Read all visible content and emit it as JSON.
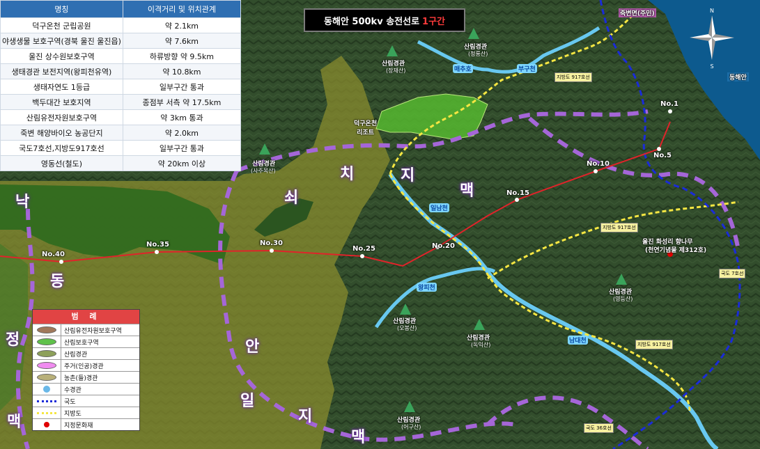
{
  "title": {
    "main": "동해안 500kv 송전선로",
    "highlight": "1구간"
  },
  "table": {
    "headers": [
      "명칭",
      "이격거리 및 위치관계"
    ],
    "rows": [
      [
        "덕구온천 군립공원",
        "약 2.1km"
      ],
      [
        "야생생물 보호구역(경북 울진 울진읍)",
        "약 7.6km"
      ],
      [
        "울진 상수원보호구역",
        "하류방향 약 9.5km"
      ],
      [
        "생태경관 보전지역(왕피천유역)",
        "약 10.8km"
      ],
      [
        "생태자연도 1등급",
        "일부구간 통과"
      ],
      [
        "백두대간 보호지역",
        "종점부 서측 약 17.5km"
      ],
      [
        "산림유전자원보호구역",
        "약 3km 통과"
      ],
      [
        "죽변 해양바이오 농공단지",
        "약 2.0km"
      ],
      [
        "국도7호선,지방도917호선",
        "일부구간 통과"
      ],
      [
        "영동선(철도)",
        "약 20km 이상"
      ]
    ]
  },
  "legend": {
    "title": "범 례",
    "items": [
      {
        "label": "산림유전자원보호구역",
        "icon": "brown-ellipse",
        "color": "#a0785a"
      },
      {
        "label": "산림보호구역",
        "icon": "green-ellipse",
        "color": "#5fc14a"
      },
      {
        "label": "산림경관",
        "icon": "olive-ellipse",
        "color": "#8da05a"
      },
      {
        "label": "주거(인공)경관",
        "icon": "pink-ellipse",
        "color": "#f08cf0"
      },
      {
        "label": "농촌(들)경관",
        "icon": "khaki-ellipse",
        "color": "#b8b07a"
      },
      {
        "label": "수경관",
        "icon": "water-drop",
        "color": "#6ab8e8"
      },
      {
        "label": "국도",
        "icon": "blue-dotted-line",
        "color": "#1a2bd8"
      },
      {
        "label": "지방도",
        "icon": "yellow-dotted-line",
        "color": "#f5e642"
      },
      {
        "label": "지정문화재",
        "icon": "red-dot",
        "color": "#e00000"
      }
    ]
  },
  "ridges": {
    "nakdong": [
      "낙",
      "동",
      "정",
      "맥"
    ],
    "anil": [
      "안",
      "일",
      "지",
      "맥"
    ],
    "chiji": [
      "치",
      "지",
      "맥"
    ],
    "soe": "쇠"
  },
  "towers": [
    "No.1",
    "No.5",
    "No.10",
    "No.15",
    "No.20",
    "No.25",
    "No.30",
    "No.35",
    "No.40"
  ],
  "places": {
    "deokgu": "덕구온천\n리조트",
    "heritage_1": "울진 화성리 향나무",
    "heritage_2": "(천연기념물 제312호)",
    "sea": "동해안"
  },
  "landscapes": [
    {
      "name": "산림경관",
      "sub": "(청룡산)"
    },
    {
      "name": "산림경관",
      "sub": "(장재산)"
    },
    {
      "name": "산림경관",
      "sub": "(사주목산)"
    },
    {
      "name": "산림경관",
      "sub": "(영등산)"
    },
    {
      "name": "산림경관",
      "sub": "(오봉산)"
    },
    {
      "name": "산림경관",
      "sub": "(독익산)"
    },
    {
      "name": "산림경관",
      "sub": "(어구산)"
    }
  ],
  "rivers": [
    "매추호",
    "부구천",
    "일남천",
    "왕피천",
    "남대천"
  ],
  "roads": {
    "local_1": "지방도 917호선",
    "local_2": "지방도 917호선",
    "local_3": "지방도 917호선",
    "national_7": "국도 7호선",
    "national_36": "국도 36호선"
  },
  "town": "죽변면(주민)"
}
